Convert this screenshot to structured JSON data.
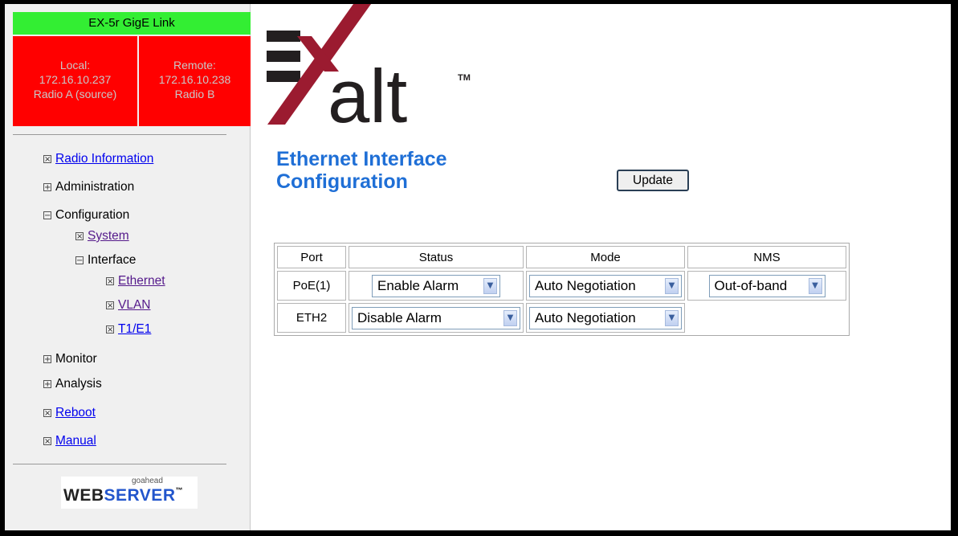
{
  "sidebar": {
    "link_title": "EX-5r GigE Link",
    "local": {
      "label": "Local:",
      "ip": "172.16.10.237",
      "radio": "Radio A (source)"
    },
    "remote": {
      "label": "Remote:",
      "ip": "172.16.10.238",
      "radio": "Radio B"
    },
    "nav": {
      "radio_information": "Radio Information",
      "administration": "Administration",
      "configuration": "Configuration",
      "system": "System",
      "interface": "Interface",
      "ethernet": "Ethernet",
      "vlan": "VLAN",
      "t1e1": "T1/E1",
      "monitor": "Monitor",
      "analysis": "Analysis",
      "reboot": "Reboot",
      "manual": "Manual"
    },
    "webserver": {
      "small": "goahead",
      "big1": "WEB",
      "big2": "SERVER",
      "tm": "™"
    }
  },
  "icons": {
    "leaf": "leaf-box-icon",
    "expand": "plus-box-icon",
    "collapse": "minus-box-icon"
  },
  "logo": {
    "text": "alt",
    "tm": "TM",
    "colors": {
      "bars": "#231f20",
      "stroke": "#9b1b30"
    }
  },
  "main": {
    "title_line1": "Ethernet Interface",
    "title_line2": "Configuration",
    "update_label": "Update",
    "table": {
      "headers": {
        "port": "Port",
        "status": "Status",
        "mode": "Mode",
        "nms": "NMS"
      },
      "rows": [
        {
          "port": "PoE(1)",
          "status": "Enable Alarm",
          "mode": "Auto Negotiation",
          "nms": "Out-of-band"
        },
        {
          "port": "ETH2",
          "status": "Disable Alarm",
          "mode": "Auto Negotiation"
        }
      ]
    }
  },
  "colors": {
    "title_blue": "#1f6fd6",
    "link_green": "#33ee33",
    "endpoint_red": "#ff0000",
    "link_blue": "#0000ee",
    "link_visited": "#551a8b"
  }
}
